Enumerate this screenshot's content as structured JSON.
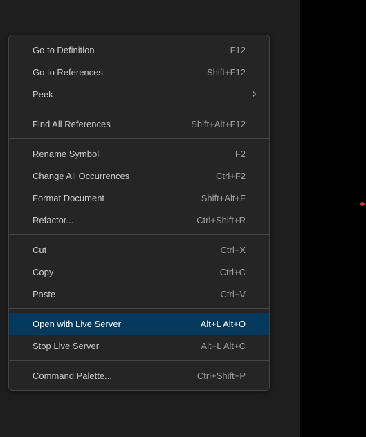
{
  "menu": {
    "groups": [
      [
        {
          "label": "Go to Definition",
          "shortcut": "F12",
          "submenu": false
        },
        {
          "label": "Go to References",
          "shortcut": "Shift+F12",
          "submenu": false
        },
        {
          "label": "Peek",
          "shortcut": "",
          "submenu": true
        }
      ],
      [
        {
          "label": "Find All References",
          "shortcut": "Shift+Alt+F12",
          "submenu": false
        }
      ],
      [
        {
          "label": "Rename Symbol",
          "shortcut": "F2",
          "submenu": false
        },
        {
          "label": "Change All Occurrences",
          "shortcut": "Ctrl+F2",
          "submenu": false
        },
        {
          "label": "Format Document",
          "shortcut": "Shift+Alt+F",
          "submenu": false
        },
        {
          "label": "Refactor...",
          "shortcut": "Ctrl+Shift+R",
          "submenu": false
        }
      ],
      [
        {
          "label": "Cut",
          "shortcut": "Ctrl+X",
          "submenu": false
        },
        {
          "label": "Copy",
          "shortcut": "Ctrl+C",
          "submenu": false
        },
        {
          "label": "Paste",
          "shortcut": "Ctrl+V",
          "submenu": false
        }
      ],
      [
        {
          "label": "Open with Live Server",
          "shortcut": "Alt+L Alt+O",
          "submenu": false,
          "highlighted": true
        },
        {
          "label": "Stop Live Server",
          "shortcut": "Alt+L Alt+C",
          "submenu": false
        }
      ],
      [
        {
          "label": "Command Palette...",
          "shortcut": "Ctrl+Shift+P",
          "submenu": false
        }
      ]
    ]
  }
}
